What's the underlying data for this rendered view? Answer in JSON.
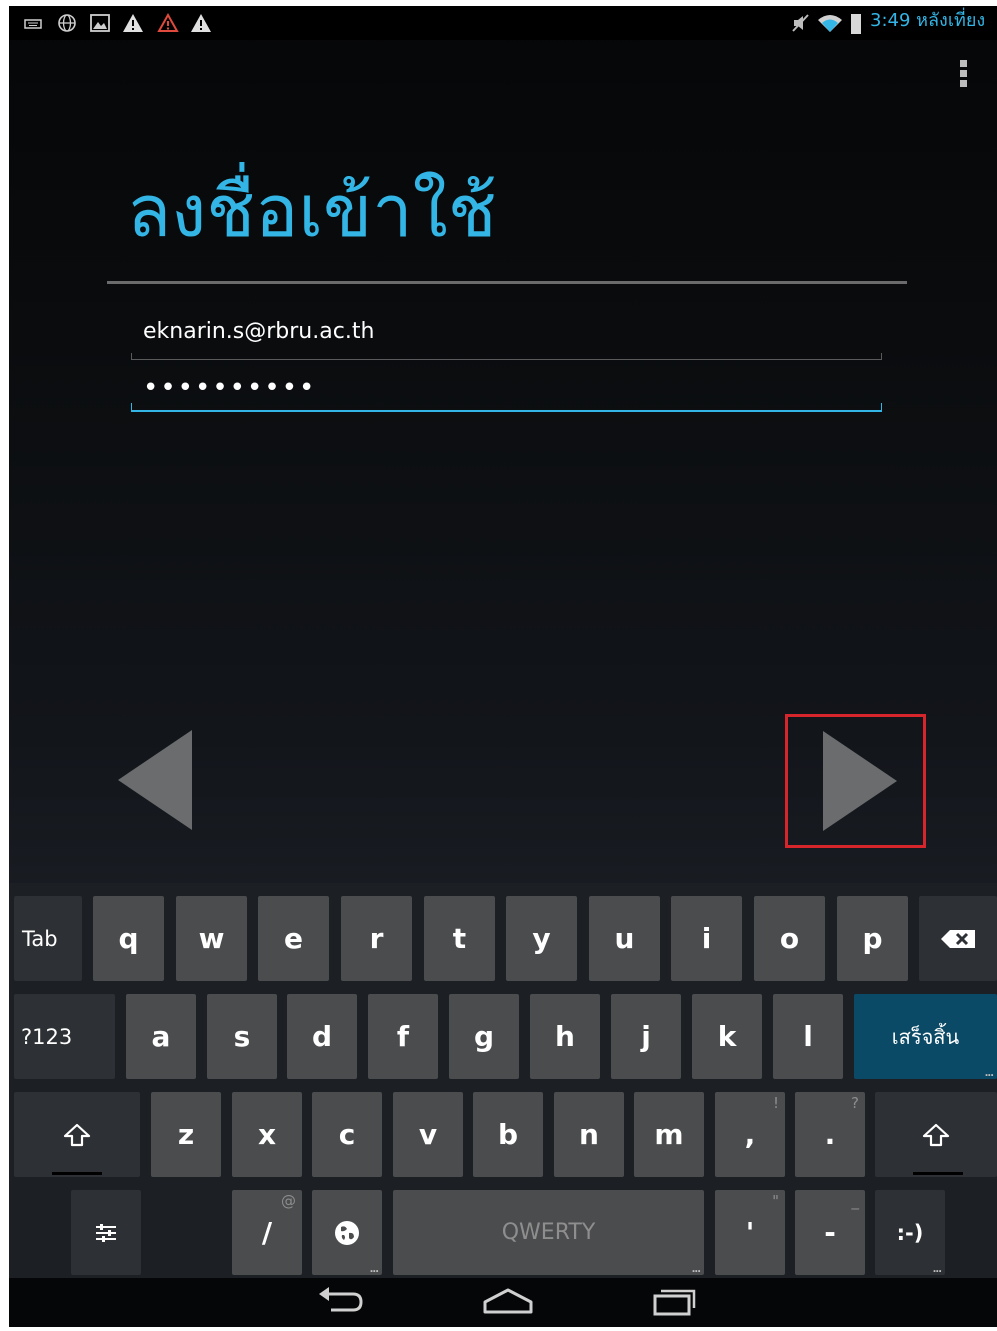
{
  "status_bar": {
    "left_icons": [
      "keyboard-icon",
      "vpn-globe-icon",
      "image-icon",
      "warning-icon",
      "alert-triangle-icon",
      "warning-icon"
    ],
    "right_icons": [
      "mute-icon",
      "wifi-icon",
      "battery-icon"
    ],
    "time": "3:49 หลังเที่ยง"
  },
  "page": {
    "title": "ลงชื่อเข้าใช้",
    "email_value": "eknarin.s@rbru.ac.th",
    "password_value": "••••••••••"
  },
  "colors": {
    "accent": "#33b5e5",
    "highlight_box": "#d6262c",
    "done_key": "#0b4a66"
  },
  "keyboard": {
    "row1": {
      "tab": "Tab",
      "keys": [
        "q",
        "w",
        "e",
        "r",
        "t",
        "y",
        "u",
        "i",
        "o",
        "p"
      ]
    },
    "row2": {
      "sym": "?123",
      "keys": [
        "a",
        "s",
        "d",
        "f",
        "g",
        "h",
        "j",
        "k",
        "l"
      ],
      "done": "เสร็จสิ้น"
    },
    "row3": {
      "keys": [
        "z",
        "x",
        "c",
        "v",
        "b",
        "n",
        "m",
        ",",
        "."
      ],
      "alt_comma": "!",
      "alt_period": "?"
    },
    "row4": {
      "slash": "/",
      "slash_alt": "@",
      "space": "QWERTY",
      "apostrophe": "'",
      "apostrophe_alt": "\"",
      "dash": "-",
      "dash_alt": "_",
      "smiley": ":-)"
    }
  },
  "nav_bar": [
    "back-icon",
    "home-icon",
    "recent-apps-icon"
  ]
}
